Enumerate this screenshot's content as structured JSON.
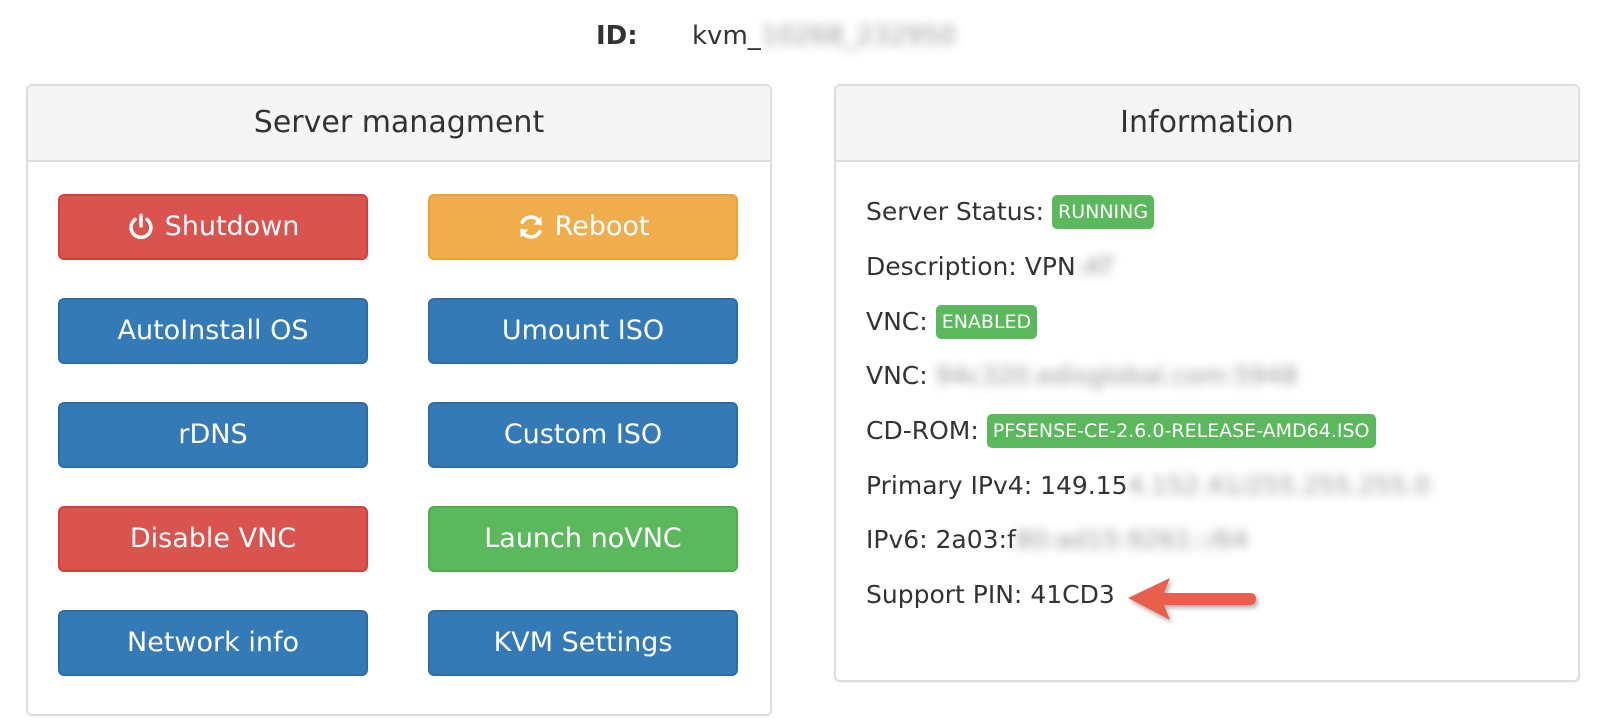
{
  "header": {
    "id_label": "ID:",
    "id_value_visible": "kvm_",
    "id_value_blurred": "10268_232950"
  },
  "management": {
    "title": "Server managment",
    "buttons": {
      "shutdown": "Shutdown",
      "reboot": "Reboot",
      "autoinstall": "AutoInstall OS",
      "umount_iso": "Umount ISO",
      "rdns": "rDNS",
      "custom_iso": "Custom ISO",
      "disable_vnc": "Disable VNC",
      "launch_novnc": "Launch noVNC",
      "network_info": "Network info",
      "kvm_settings": "KVM Settings"
    }
  },
  "information": {
    "title": "Information",
    "server_status": {
      "label": "Server Status:",
      "badge": "RUNNING"
    },
    "description": {
      "label": "Description:",
      "value": "VPN",
      "value_blurred": "-AT"
    },
    "vnc_status": {
      "label": "VNC:",
      "badge": "ENABLED"
    },
    "vnc_address": {
      "label": "VNC:",
      "value_blurred": "94c320.edisglobal.com:5948"
    },
    "cdrom": {
      "label": "CD-ROM:",
      "badge": "PFSENSE-CE-2.6.0-RELEASE-AMD64.ISO"
    },
    "primary_ipv4": {
      "label": "Primary IPv4:",
      "value": "149.15",
      "value_blurred": "4.152.41/255.255.255.0"
    },
    "ipv6": {
      "label": "IPv6:",
      "value": "2a03:f",
      "value_blurred": "80:ad15:9261::/64"
    },
    "support_pin": {
      "label": "Support PIN:",
      "value": "41CD3"
    }
  },
  "colors": {
    "danger": "#d9534f",
    "warning": "#f0ad4e",
    "primary": "#337ab7",
    "success": "#5cb85c",
    "annotation_arrow": "#e8604c"
  }
}
